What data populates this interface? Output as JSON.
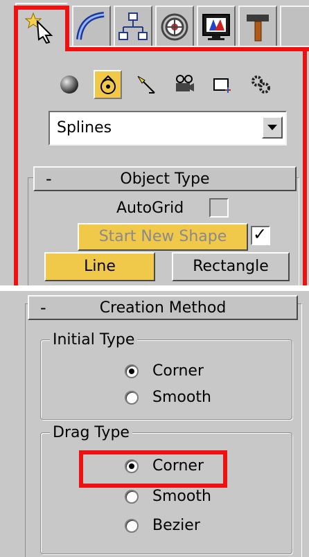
{
  "tabs": [
    {
      "name": "Create",
      "icon": "create-arrow-star-icon",
      "active": true
    },
    {
      "name": "Modify",
      "icon": "modify-curve-icon",
      "active": false
    },
    {
      "name": "Hierarchy",
      "icon": "hierarchy-icon",
      "active": false
    },
    {
      "name": "Motion",
      "icon": "motion-wheel-icon",
      "active": false
    },
    {
      "name": "Display",
      "icon": "display-monitor-icon",
      "active": false
    },
    {
      "name": "Utilities",
      "icon": "utilities-hammer-icon",
      "active": false
    }
  ],
  "categories": [
    {
      "icon": "geometry-sphere-icon",
      "active": false
    },
    {
      "icon": "shapes-icon",
      "active": true
    },
    {
      "icon": "lights-icon",
      "active": false
    },
    {
      "icon": "cameras-icon",
      "active": false
    },
    {
      "icon": "helpers-icon",
      "active": false
    },
    {
      "icon": "systems-gears-icon",
      "active": false
    }
  ],
  "dropdown": {
    "value": "Splines"
  },
  "object_type": {
    "title": "Object Type",
    "collapse": "-",
    "autogrid_label": "AutoGrid",
    "autogrid_checked": false,
    "start_new_shape_label": "Start New Shape",
    "start_new_shape_checked": true,
    "buttons": [
      "Line",
      "Rectangle"
    ]
  },
  "creation_method": {
    "title": "Creation Method",
    "collapse": "-",
    "initial_type": {
      "title": "Initial Type",
      "options": [
        "Corner",
        "Smooth"
      ],
      "selected": "Corner"
    },
    "drag_type": {
      "title": "Drag Type",
      "options": [
        "Corner",
        "Smooth",
        "Bezier"
      ],
      "selected": "Corner"
    }
  },
  "colors": {
    "highlight_red": "#ee1111",
    "active_yellow": "#f0c84a",
    "panel_gray": "#c8c8c8"
  }
}
